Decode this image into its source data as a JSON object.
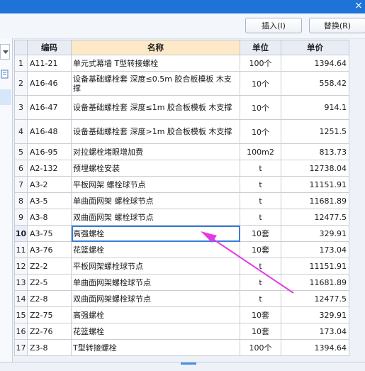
{
  "title_close": "×",
  "toolbar": {
    "insert_label": "插入(I)",
    "replace_label": "替换(R)"
  },
  "columns": [
    "编码",
    "名称",
    "单位",
    "单价"
  ],
  "rows": [
    {
      "no": "1",
      "code": "A11-21",
      "name": "单元式幕墙 T型转接螺栓",
      "unit": "100个",
      "price": "1394.64"
    },
    {
      "no": "2",
      "code": "A16-46",
      "name": "设备基础螺栓套 深度≤0.5m 胶合板模板 木支撑",
      "unit": "10个",
      "price": "558.42"
    },
    {
      "no": "3",
      "code": "A16-47",
      "name": "设备基础螺栓套 深度≤1m 胶合板模板 木支撑",
      "unit": "10个",
      "price": "914.1"
    },
    {
      "no": "4",
      "code": "A16-48",
      "name": "设备基础螺栓套 深度>1m 胶合板模板 木支撑",
      "unit": "10个",
      "price": "1251.5"
    },
    {
      "no": "5",
      "code": "A16-95",
      "name": "对拉螺栓堵眼增加费",
      "unit": "100m2",
      "price": "813.73"
    },
    {
      "no": "6",
      "code": "A2-132",
      "name": "预埋螺栓安装",
      "unit": "t",
      "price": "12738.04"
    },
    {
      "no": "7",
      "code": "A3-2",
      "name": "平板网架 螺栓球节点",
      "unit": "t",
      "price": "11151.91"
    },
    {
      "no": "8",
      "code": "A3-5",
      "name": "单曲面网架 螺栓球节点",
      "unit": "t",
      "price": "11681.89"
    },
    {
      "no": "9",
      "code": "A3-8",
      "name": "双曲面网架 螺栓球节点",
      "unit": "t",
      "price": "12477.5"
    },
    {
      "no": "10",
      "code": "A3-75",
      "name": "高强螺栓",
      "unit": "10套",
      "price": "329.91"
    },
    {
      "no": "11",
      "code": "A3-76",
      "name": "花篮螺栓",
      "unit": "10套",
      "price": "173.04"
    },
    {
      "no": "12",
      "code": "Z2-2",
      "name": "平板网架螺栓球节点",
      "unit": "t",
      "price": "11151.91"
    },
    {
      "no": "13",
      "code": "Z2-5",
      "name": "单曲面网架螺栓球节点",
      "unit": "t",
      "price": "11681.89"
    },
    {
      "no": "14",
      "code": "Z2-8",
      "name": "双曲面网架螺栓球节点",
      "unit": "t",
      "price": "12477.5"
    },
    {
      "no": "15",
      "code": "Z2-75",
      "name": "高强螺栓",
      "unit": "10套",
      "price": "329.91"
    },
    {
      "no": "16",
      "code": "Z2-76",
      "name": "花篮螺栓",
      "unit": "10套",
      "price": "173.04"
    },
    {
      "no": "17",
      "code": "Z3-8",
      "name": "T型转接螺栓",
      "unit": "100个",
      "price": "1394.64"
    }
  ],
  "selected_row": "10",
  "colors": {
    "accent": "#1e73d8",
    "annotation_arrow": "#e23be6",
    "header_highlight": "#fde9c8"
  },
  "icons": {
    "title_close": "close-icon",
    "left_dropdown": "chevron-down-icon",
    "left_tool": "document-icon"
  }
}
